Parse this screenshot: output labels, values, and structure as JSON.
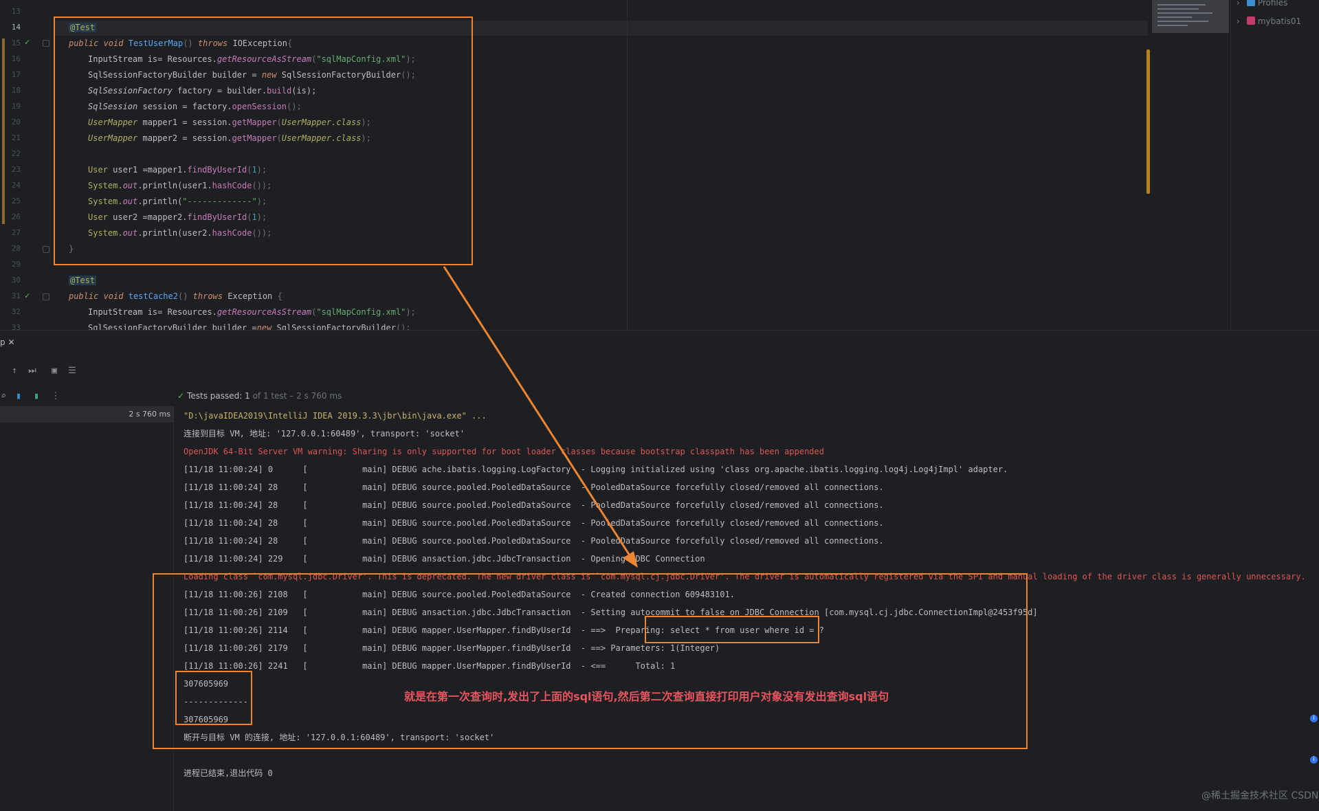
{
  "editor": {
    "line_numbers": [
      "13",
      "14",
      "15",
      "16",
      "17",
      "18",
      "19",
      "20",
      "21",
      "22",
      "23",
      "24",
      "25",
      "26",
      "27",
      "28",
      "29",
      "30",
      "31",
      "32",
      "33"
    ],
    "current_line": "14",
    "code": {
      "l14": {
        "ann": "@Test"
      },
      "l15": {
        "a": "public void",
        "b": "TestUserMap",
        "c": "()",
        "d": "throws",
        "e": "IOException",
        "f": "{"
      },
      "l16": {
        "a": "InputStream is= Resources.",
        "b": "getResourceAsStream",
        "c": "(",
        "d": "\"sqlMapConfig.xml\"",
        "e": ");"
      },
      "l17": {
        "a": "SqlSessionFactoryBuilder",
        "b": " builder = ",
        "c": "new",
        "d": " SqlSessionFactoryBuilder",
        "e": "();"
      },
      "l18": {
        "a": "SqlSessionFactory",
        "b": " factory = builder.",
        "c": "build",
        "d": "(is);"
      },
      "l19": {
        "a": "SqlSession",
        "b": " session = factory.",
        "c": "openSession",
        "d": "();"
      },
      "l20": {
        "a": "UserMapper",
        "b": " mapper1 = session.",
        "c": "getMapper",
        "d": "(",
        "e": "UserMapper.class",
        "f": ");"
      },
      "l21": {
        "a": "UserMapper",
        "b": " mapper2 = session.",
        "c": "getMapper",
        "d": "(",
        "e": "UserMapper.class",
        "f": ");"
      },
      "l23": {
        "a": "User",
        "b": " user1 =mapper1.",
        "c": "findByUserId",
        "d": "(",
        "e": "1",
        "f": ");"
      },
      "l24": {
        "a": "System.",
        "b": "out",
        "c": ".println(user1.",
        "d": "hashCode",
        "e": "());"
      },
      "l25": {
        "a": "System.",
        "b": "out",
        "c": ".println(",
        "d": "\"-------------\"",
        "e": ");"
      },
      "l26": {
        "a": "User",
        "b": " user2 =mapper2.",
        "c": "findByUserId",
        "d": "(",
        "e": "1",
        "f": ");"
      },
      "l27": {
        "a": "System.",
        "b": "out",
        "c": ".println(user2.",
        "d": "hashCode",
        "e": "());"
      },
      "l28": {
        "a": "}"
      },
      "l30": {
        "ann": "@Test"
      },
      "l31": {
        "a": "public void",
        "b": "testCache2",
        "c": "()",
        "d": "throws",
        "e": "Exception",
        "f": "{"
      },
      "l32": {
        "a": "InputStream is= Resources.",
        "b": "getResourceAsStream",
        "c": "(",
        "d": "\"sqlMapConfig.xml\"",
        "e": ");"
      },
      "l33": {
        "a": "SqlSessionFactoryBuilder",
        "b": " builder =",
        "c": "new",
        "d": " SqlSessionFactoryBuilder",
        "e": "();"
      }
    }
  },
  "project": {
    "items": [
      {
        "label": "Profiles",
        "icon_color": "#3a8fd1"
      },
      {
        "label": "mybatis01",
        "icon_color": "#c23d6a"
      }
    ]
  },
  "run": {
    "tab_label": "p",
    "status": {
      "label": "Tests passed:",
      "count": "1",
      "of": "of 1 test – 2 s 760 ms"
    },
    "tree_duration": "2 s 760 ms",
    "log_lines": [
      {
        "kind": "path",
        "text": "\"D:\\javaIDEA2019\\IntelliJ IDEA 2019.3.3\\jbr\\bin\\java.exe\" ..."
      },
      {
        "kind": "normal",
        "text": "连接到目标 VM, 地址: '127.0.0.1:60489', transport: 'socket'"
      },
      {
        "kind": "warn",
        "text": "OpenJDK 64-Bit Server VM warning: Sharing is only supported for boot loader classes because bootstrap classpath has been appended"
      },
      {
        "kind": "normal",
        "text": "[11/18 11:00:24] 0      [           main] DEBUG ache.ibatis.logging.LogFactory  - Logging initialized using 'class org.apache.ibatis.logging.log4j.Log4jImpl' adapter."
      },
      {
        "kind": "normal",
        "text": "[11/18 11:00:24] 28     [           main] DEBUG source.pooled.PooledDataSource  - PooledDataSource forcefully closed/removed all connections."
      },
      {
        "kind": "normal",
        "text": "[11/18 11:00:24] 28     [           main] DEBUG source.pooled.PooledDataSource  - PooledDataSource forcefully closed/removed all connections."
      },
      {
        "kind": "normal",
        "text": "[11/18 11:00:24] 28     [           main] DEBUG source.pooled.PooledDataSource  - PooledDataSource forcefully closed/removed all connections."
      },
      {
        "kind": "normal",
        "text": "[11/18 11:00:24] 28     [           main] DEBUG source.pooled.PooledDataSource  - PooledDataSource forcefully closed/removed all connections."
      },
      {
        "kind": "normal",
        "text": "[11/18 11:00:24] 229    [           main] DEBUG ansaction.jdbc.JdbcTransaction  - Opening JDBC Connection"
      },
      {
        "kind": "warn",
        "text": "Loading class `com.mysql.jdbc.Driver'. This is deprecated. The new driver class is `com.mysql.cj.jdbc.Driver'. The driver is automatically registered via the SPI and manual loading of the driver class is generally unnecessary."
      },
      {
        "kind": "normal",
        "text": "[11/18 11:00:26] 2108   [           main] DEBUG source.pooled.PooledDataSource  - Created connection 609483101."
      },
      {
        "kind": "normal",
        "text": "[11/18 11:00:26] 2109   [           main] DEBUG ansaction.jdbc.JdbcTransaction  - Setting autocommit to false on JDBC Connection [com.mysql.cj.jdbc.ConnectionImpl@2453f95d]"
      },
      {
        "kind": "normal",
        "text": "[11/18 11:00:26] 2114   [           main] DEBUG mapper.UserMapper.findByUserId  - ==>  Preparing: select * from user where id = ?"
      },
      {
        "kind": "normal",
        "text": "[11/18 11:00:26] 2179   [           main] DEBUG mapper.UserMapper.findByUserId  - ==> Parameters: 1(Integer)"
      },
      {
        "kind": "normal",
        "text": "[11/18 11:00:26] 2241   [           main] DEBUG mapper.UserMapper.findByUserId  - <==      Total: 1"
      },
      {
        "kind": "normal",
        "text": "307605969"
      },
      {
        "kind": "normal",
        "text": "-------------"
      },
      {
        "kind": "normal",
        "text": "307605969"
      },
      {
        "kind": "normal",
        "text": "断开与目标 VM 的连接, 地址: '127.0.0.1:60489', transport: 'socket'"
      },
      {
        "kind": "normal",
        "text": ""
      },
      {
        "kind": "normal",
        "text": "进程已结束,退出代码 0"
      }
    ]
  },
  "annotation": {
    "note": "就是在第一次查询时,发出了上面的sql语句,然后第二次查询直接打印用户对象没有发出查询sql语句",
    "arrow_color": "#ef8532"
  },
  "watermark": "@稀土掘金技术社区 CSDN @木小纪",
  "colors": {
    "accent": "#ef8532",
    "pass": "#5fb85f",
    "warn": "#e05555"
  }
}
